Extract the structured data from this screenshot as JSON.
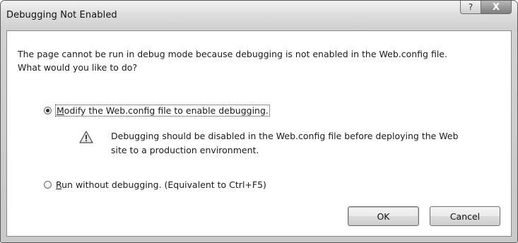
{
  "dialog": {
    "title": "Debugging Not Enabled",
    "help_glyph": "?",
    "close_glyph": "X",
    "message_line1": "The page cannot be run in debug mode because debugging is not enabled in the Web.config file.",
    "message_line2": "What would you like to do?",
    "option_modify": {
      "mnemonic": "M",
      "rest": "odify the Web.config file to enable debugging.",
      "selected": true
    },
    "warning": {
      "icon": "warning-icon",
      "line1": "Debugging should be disabled in the Web.config file before deploying the Web",
      "line2": "site to a production environment."
    },
    "option_run": {
      "mnemonic": "R",
      "rest": "un without debugging. (Equivalent to Ctrl+F5)",
      "selected": false
    },
    "ok_label": "OK",
    "cancel_label": "Cancel"
  }
}
